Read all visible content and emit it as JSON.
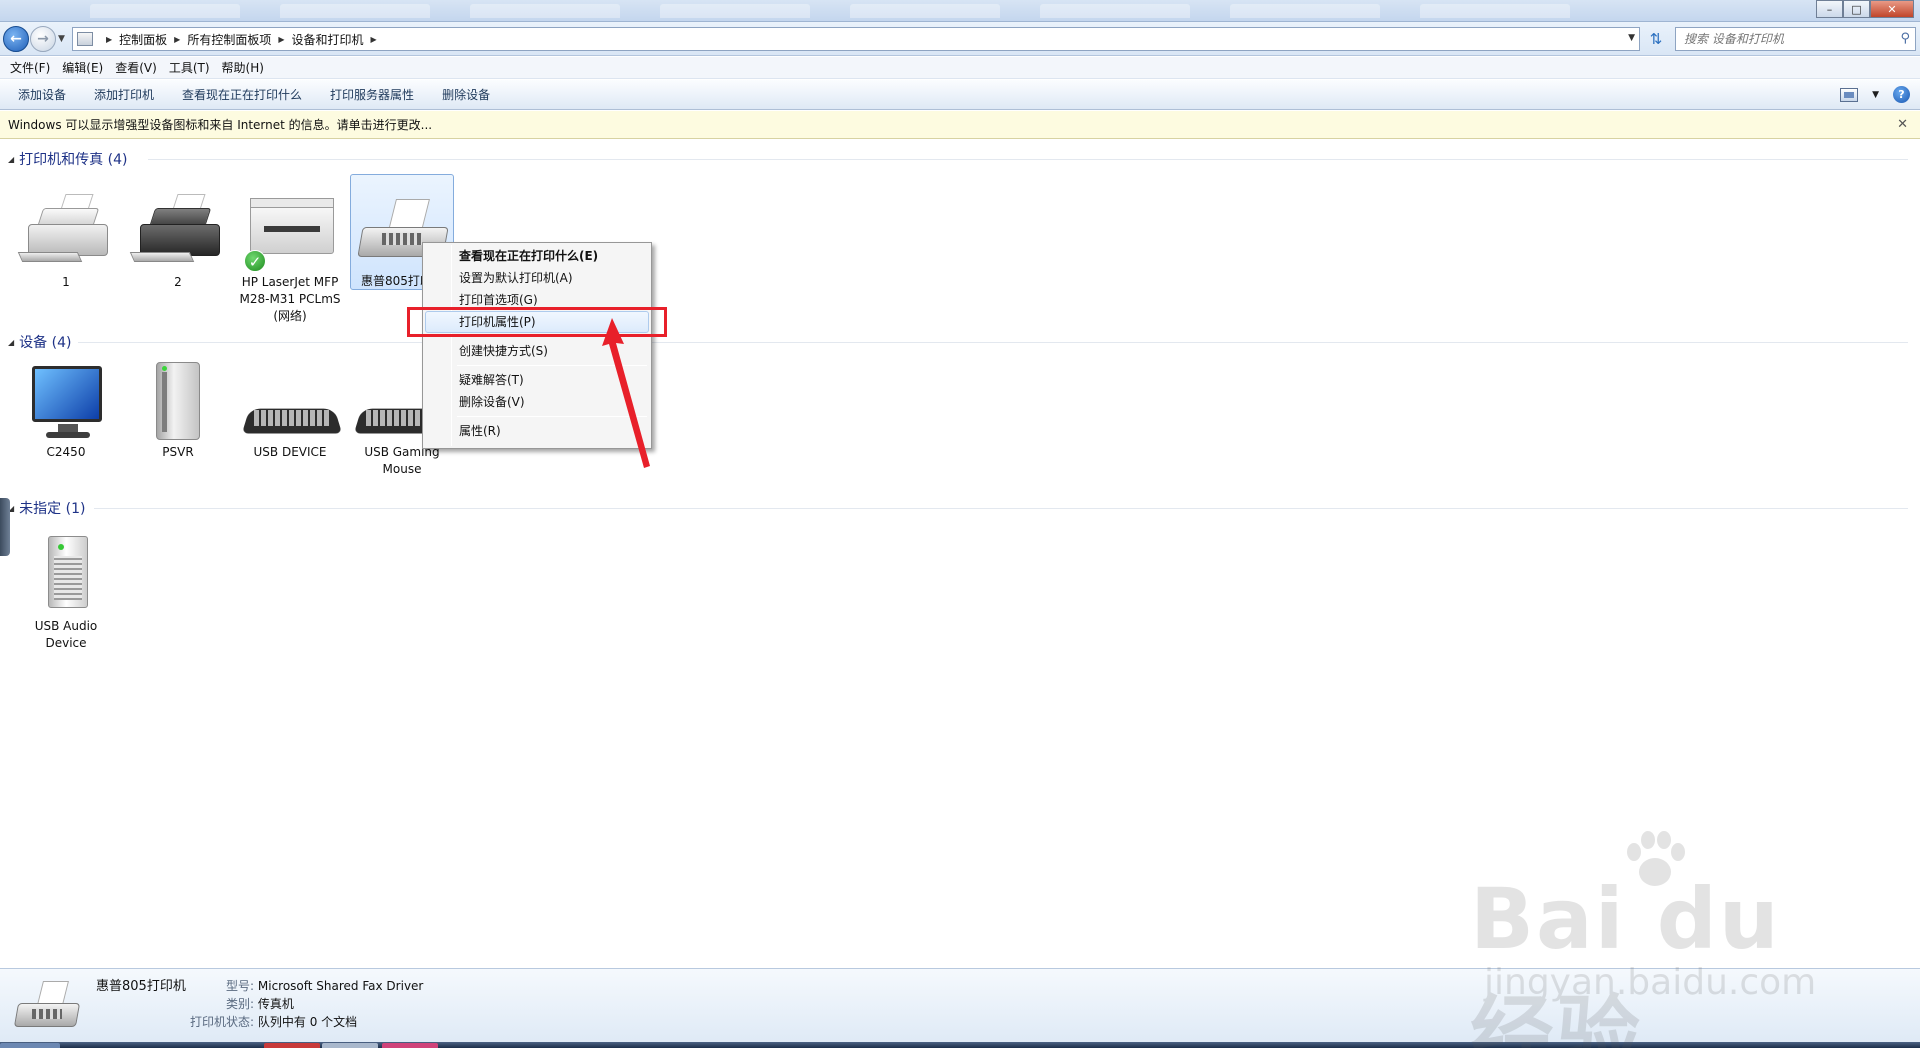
{
  "address": {
    "breadcrumb": [
      "控制面板",
      "所有控制面板项",
      "设备和打印机"
    ],
    "search_placeholder": "搜索 设备和打印机"
  },
  "menu": [
    "文件(F)",
    "编辑(E)",
    "查看(V)",
    "工具(T)",
    "帮助(H)"
  ],
  "commands": [
    "添加设备",
    "添加打印机",
    "查看现在正在打印什么",
    "打印服务器属性",
    "删除设备"
  ],
  "info_bar": "Windows 可以显示增强型设备图标和来自 Internet 的信息。请单击进行更改...",
  "groups": {
    "printers": {
      "title": "打印机和传真 (4)",
      "items": [
        {
          "label": "1"
        },
        {
          "label": "2"
        },
        {
          "label": "HP LaserJet MFP M28-M31 PCLmS (网络)",
          "default": true
        },
        {
          "label": "惠普805打印机"
        }
      ]
    },
    "devices": {
      "title": "设备 (4)",
      "items": [
        {
          "label": "C2450"
        },
        {
          "label": "PSVR"
        },
        {
          "label": "USB DEVICE"
        },
        {
          "label": "USB Gaming Mouse"
        }
      ]
    },
    "unspecified": {
      "title": "未指定 (1)",
      "items": [
        {
          "label": "USB Audio Device"
        }
      ]
    }
  },
  "printer_tile_label_visible": "惠普805打印",
  "context_menu": {
    "items": [
      "查看现在正在打印什么(E)",
      "设置为默认打印机(A)",
      "打印首选项(G)",
      "打印机属性(P)",
      "创建快捷方式(S)",
      "疑难解答(T)",
      "删除设备(V)",
      "属性(R)"
    ],
    "highlighted_index": 3
  },
  "details": {
    "name": "惠普805打印机",
    "model_key": "型号:",
    "model_value": "Microsoft Shared Fax Driver",
    "category_key": "类别:",
    "category_value": "传真机",
    "status_key": "打印机状态:",
    "status_value": "队列中有 0 个文档"
  },
  "watermark": {
    "brand": "Bai du 经验",
    "url": "jingyan.baidu.com"
  },
  "colors": {
    "group_title": "#1e3287",
    "info_bar_bg": "#fdfbe0",
    "annotation_red": "#e8202a",
    "selection_border": "#84acdd"
  }
}
